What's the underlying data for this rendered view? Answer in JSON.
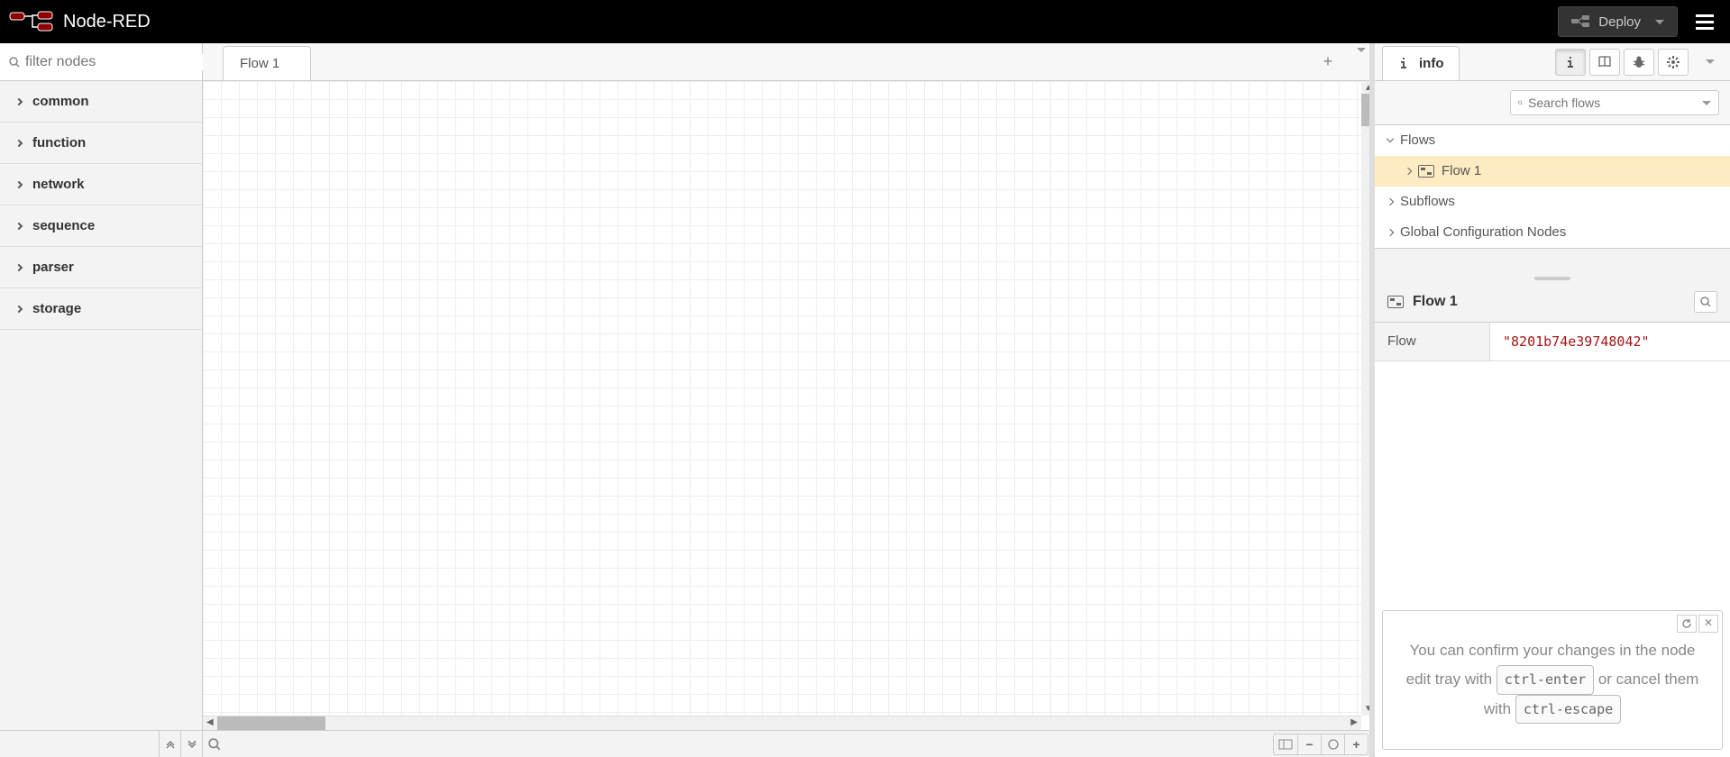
{
  "header": {
    "app_name": "Node-RED",
    "deploy_label": "Deploy"
  },
  "palette": {
    "filter_placeholder": "filter nodes",
    "categories": [
      "common",
      "function",
      "network",
      "sequence",
      "parser",
      "storage"
    ]
  },
  "workspace": {
    "tabs": [
      {
        "label": "Flow 1"
      }
    ]
  },
  "sidebar": {
    "info_label": "info",
    "search_placeholder": "Search flows",
    "tree": {
      "flows_label": "Flows",
      "flow_items": [
        {
          "label": "Flow 1"
        }
      ],
      "subflows_label": "Subflows",
      "global_label": "Global Configuration Nodes"
    },
    "detail": {
      "title": "Flow 1",
      "rows": [
        {
          "label": "Flow",
          "value": "\"8201b74e39748042\""
        }
      ]
    },
    "tip": {
      "pre_kbd1": "You can confirm your changes in the node edit tray with ",
      "kbd1": "ctrl-enter",
      "mid": " or cancel them with ",
      "kbd2": "ctrl-escape"
    }
  }
}
